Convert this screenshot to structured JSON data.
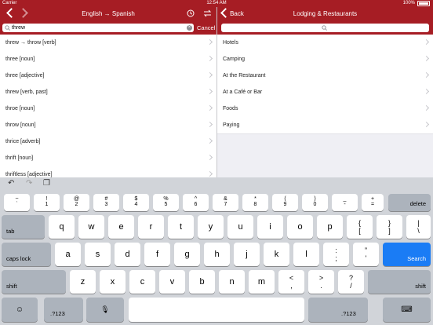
{
  "status": {
    "carrier": "Carrier",
    "time": "12:54 AM",
    "battery": "100%"
  },
  "left": {
    "title": "English → Spanish",
    "search_value": "threw",
    "cancel_label": "Cancel",
    "rows": [
      "threw → throw [verb]",
      "three [noun]",
      "three [adjective]",
      "threw [verb, past]",
      "throe [noun]",
      "throw [noun]",
      "thrice [adverb]",
      "thrift [noun]",
      "thriftless [adjective]"
    ]
  },
  "right": {
    "back_label": "Back",
    "title": "Lodging & Restaurants",
    "rows": [
      "Hotels",
      "Camping",
      "At the Restaurant",
      "At a Café or Bar",
      "Foods",
      "Paying"
    ]
  },
  "keyboard": {
    "number_row": [
      {
        "top": "~",
        "bottom": "`"
      },
      {
        "top": "!",
        "bottom": "1"
      },
      {
        "top": "@",
        "bottom": "2"
      },
      {
        "top": "#",
        "bottom": "3"
      },
      {
        "top": "$",
        "bottom": "4"
      },
      {
        "top": "%",
        "bottom": "5"
      },
      {
        "top": "^",
        "bottom": "6"
      },
      {
        "top": "&",
        "bottom": "7"
      },
      {
        "top": "*",
        "bottom": "8"
      },
      {
        "top": "(",
        "bottom": "9"
      },
      {
        "top": ")",
        "bottom": "0"
      },
      {
        "top": "_",
        "bottom": "-"
      },
      {
        "top": "+",
        "bottom": "="
      }
    ],
    "delete": "delete",
    "tab": "tab",
    "row_q": [
      "q",
      "w",
      "e",
      "r",
      "t",
      "y",
      "u",
      "i",
      "o",
      "p"
    ],
    "row_q_extra": [
      {
        "top": "{",
        "bottom": "["
      },
      {
        "top": "}",
        "bottom": "]"
      },
      {
        "top": "|",
        "bottom": "\\"
      }
    ],
    "caps": "caps lock",
    "row_a": [
      "a",
      "s",
      "d",
      "f",
      "g",
      "h",
      "j",
      "k",
      "l"
    ],
    "row_a_extra": [
      {
        "top": ":",
        "bottom": ";"
      },
      {
        "top": "”",
        "bottom": "'"
      }
    ],
    "search": "Search",
    "shift": "shift",
    "row_z": [
      "z",
      "x",
      "c",
      "v",
      "b",
      "n",
      "m"
    ],
    "row_z_extra": [
      {
        "top": "<",
        "bottom": ","
      },
      {
        "top": ">",
        "bottom": "."
      },
      {
        "top": "?",
        "bottom": "/"
      }
    ],
    "num_toggle": ".?123"
  }
}
